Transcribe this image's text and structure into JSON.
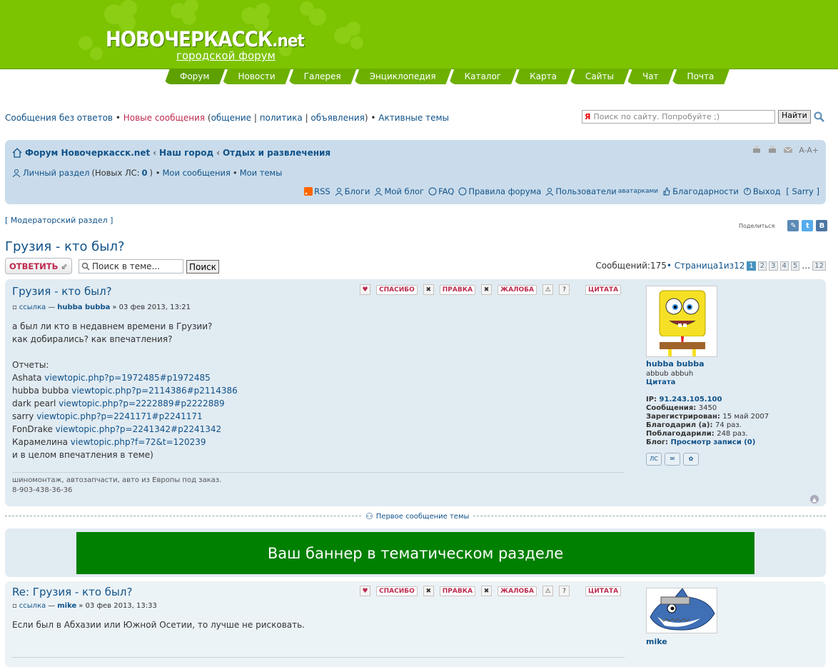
{
  "site": {
    "logo": "НОВОЧЕРКАССК",
    "logo_suffix": ".net",
    "subtitle": "городской форум",
    "nav": [
      "Форум",
      "Новости",
      "Галерея",
      "Энциклопедия",
      "Каталог",
      "Карта",
      "Сайты",
      "Чат",
      "Почта"
    ]
  },
  "toplinks": {
    "unanswered": "Сообщения без ответов",
    "new": "Новые сообщения",
    "open_paren": " (",
    "cat1": "общение",
    "sep": " | ",
    "cat2": "политика",
    "cat3": "объявления",
    "close_paren": ") • ",
    "active": "Активные темы"
  },
  "search": {
    "placeholder": "Поиск по сайту. Попробуйте ;)",
    "ya": "Я",
    "button": "Найти"
  },
  "breadcrumbs": [
    "Форум Новочеркасск.net",
    "Наш город",
    "Отдых и развлечения"
  ],
  "fontsize": "A-A+",
  "personal": {
    "label": "Личный раздел",
    "new_pm_prefix": " (Новых ЛС: ",
    "new_pm_count": "0",
    "new_pm_suffix": ") • ",
    "my_posts": "Мои сообщения",
    "dot": " • ",
    "my_topics": "Мои темы"
  },
  "quicklinks": {
    "rss": "RSS",
    "blogs": "Блоги",
    "myblog": "Мой блог",
    "faq": "FAQ",
    "rules": "Правила форума",
    "users": "Пользователи",
    "users_small": "аватарками",
    "thanks": "Благодарности",
    "logout": "Выход",
    "logout_user": "[ Sarry ]"
  },
  "modsection": "[  Модераторский раздел  ]",
  "share_label": "Поделиться",
  "topic_title": "Грузия - кто был?",
  "actions": {
    "reply": "ОТВЕТИТЬ",
    "search_value": "Поиск в теме...",
    "search_button": "Поиск",
    "post_count_prefix": "Сообщений: ",
    "post_count": "175",
    "page_text": " • Страница ",
    "page_cur": "1",
    "page_of": " из ",
    "page_total": "12",
    "pages": [
      "1",
      "2",
      "3",
      "4",
      "5"
    ],
    "ellipsis": "…",
    "last": "12"
  },
  "post_buttons": {
    "thanks": "СПАСИБО",
    "edit": "ПРАВКА",
    "report": "ЖАЛОБА",
    "quote": "ЦИТАТА"
  },
  "post1": {
    "title": "Грузия - кто был?",
    "link": "ссылка",
    "dash": " — ",
    "author": "hubba bubba",
    "date": "» 03 фев 2013, 13:21",
    "line1": "а был ли кто в недавнем времени в Грузии?",
    "line2": "как добирались? как впечатления?",
    "reports_label": "Отчеты:",
    "reports": [
      {
        "name": "Ashata ",
        "url": "viewtopic.php?p=1972485#p1972485"
      },
      {
        "name": "hubba bubba ",
        "url": "viewtopic.php?p=2114386#p2114386"
      },
      {
        "name": "dark pearl ",
        "url": "viewtopic.php?p=2222889#p2222889"
      },
      {
        "name": "sarry ",
        "url": "viewtopic.php?p=2241171#p2241171"
      },
      {
        "name": "FonDrake ",
        "url": "viewtopic.php?p=2241342#p2241342"
      },
      {
        "name": "Карамелина ",
        "url": "viewtopic.php?f=72&t=120239"
      }
    ],
    "last_line": "и в целом впечатления в теме)",
    "sig1": "шиномонтаж, автозапчасти, авто из Европы под заказ.",
    "sig2": "8-903-438-36-36",
    "profile": {
      "username": "hubba bubba",
      "rank": "abbub abbuh",
      "quote_label": "Цитата",
      "ip_label": "IP: ",
      "ip": "91.243.105.100",
      "posts_label": "Сообщения: ",
      "posts": "3450",
      "reg_label": "Зарегистрирован: ",
      "reg": "15 май 2007",
      "thanked_label": "Благодарил (а): ",
      "thanked": "74 раз.",
      "was_thanked_label": "Поблагодарили: ",
      "was_thanked": "248 раз.",
      "blog_label": "Блог: ",
      "blog": "Просмотр записи (0)",
      "pm_label": "ЛС"
    }
  },
  "first_post_link": "Первое сообщение темы",
  "banner": "Ваш баннер в тематическом разделе",
  "post2": {
    "title": "Re: Грузия - кто был?",
    "link": "ссылка",
    "dash": " — ",
    "author": "mike",
    "date": "» 03 фев 2013, 13:33",
    "text": "Если был в Абхазии или Южной Осетии, то лучше не рисковать.",
    "username": "mike"
  }
}
